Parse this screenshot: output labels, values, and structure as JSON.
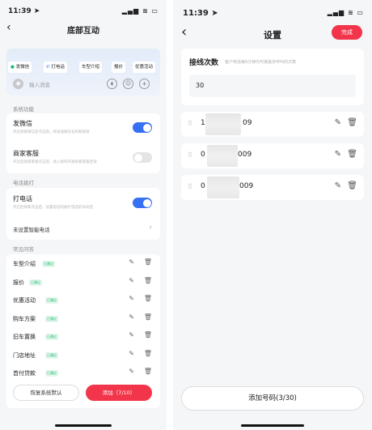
{
  "left": {
    "status": {
      "time": "11:39 ➤",
      "icons": "▂▄▆ ≋ ▭"
    },
    "nav": {
      "back": "‹",
      "title": "底部互动"
    },
    "quick_buttons": [
      "发微信",
      "打电话",
      "车型介绍",
      "报价",
      "优惠活动"
    ],
    "input_placeholder": "输入消息",
    "system_section": "系统功能",
    "wechat": {
      "label": "发微信",
      "sub": "开启商家微信后点击后，将发送微信号码和链接"
    },
    "merchant": {
      "label": "商家客服",
      "sub": "开启后商家客服点击后，进入如何开通商家客服咨询"
    },
    "phone_section": "电话拨打",
    "call": {
      "label": "打电话",
      "sub": "开启后商家点击后，设置电话的拨打电话的号码后"
    },
    "smart_phone": "未设置智能电话",
    "faq_section": "常见问答",
    "faq_tag": "已通过",
    "faq": [
      "车型介绍",
      "报价",
      "优惠活动",
      "购车方案",
      "旧车置换",
      "门店地址",
      "首付贷款"
    ],
    "restore_button": "恢复系统默认",
    "add_button": "添加（7/10）",
    "colors": {
      "accent": "#3670f3",
      "red": "#f2354a",
      "green": "#18b870"
    }
  },
  "right": {
    "status": {
      "time": "11:39 ➤",
      "icons": "▂▄▆ ≋ ▭"
    },
    "nav": {
      "back": "‹",
      "title": "设置"
    },
    "done_button": "完成",
    "line_count_label": "接线次数",
    "line_count_sub": "客户电话每6分钟内可接最多呼叫的次数",
    "line_count_value": "30",
    "numbers": [
      {
        "prefix": "1",
        "suffix": "09"
      },
      {
        "prefix": "0",
        "suffix": "009"
      },
      {
        "prefix": "0",
        "suffix": "009"
      }
    ],
    "add_number_button": "添加号码(3/30)"
  }
}
